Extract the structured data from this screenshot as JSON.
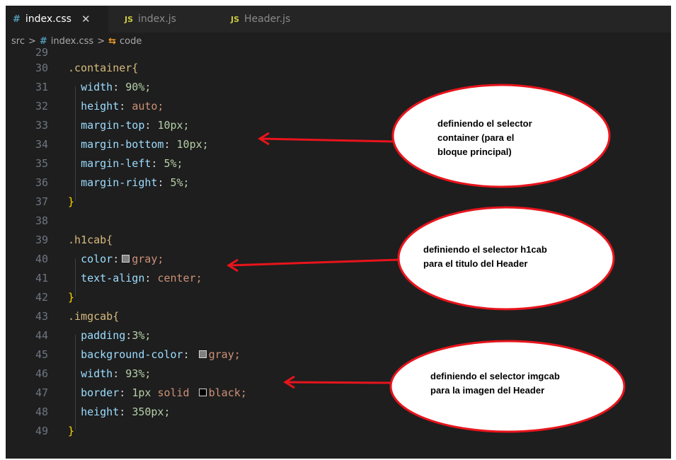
{
  "tabs": [
    {
      "label": "index.css",
      "icon": "#",
      "close": "✕",
      "active": true
    },
    {
      "label": "index.js",
      "icon": "JS",
      "active": false
    },
    {
      "label": "Header.js",
      "icon": "JS",
      "active": false
    }
  ],
  "breadcrumb": {
    "folder": "src",
    "sep": ">",
    "file": "index.css",
    "symbol": "code"
  },
  "code": {
    "partial_line": "29",
    "lines": [
      {
        "n": "30",
        "text": ".container{"
      },
      {
        "n": "31",
        "prop": "width",
        "value": "90%;"
      },
      {
        "n": "32",
        "prop": "height",
        "value": "auto;"
      },
      {
        "n": "33",
        "prop": "margin-top",
        "value": "10px;"
      },
      {
        "n": "34",
        "prop": "margin-bottom",
        "value": "10px;"
      },
      {
        "n": "35",
        "prop": "margin-left",
        "value": "5%;"
      },
      {
        "n": "36",
        "prop": "margin-right",
        "value": "5%;"
      },
      {
        "n": "37",
        "text": "}"
      },
      {
        "n": "38",
        "text": ""
      },
      {
        "n": "39",
        "text": ".h1cab{"
      },
      {
        "n": "40",
        "prop": "color",
        "value": "gray;"
      },
      {
        "n": "41",
        "prop": "text-align",
        "value": "center;"
      },
      {
        "n": "42",
        "text": "}"
      },
      {
        "n": "43",
        "text": ".imgcab{"
      },
      {
        "n": "44",
        "prop": "padding",
        "value": "3%;"
      },
      {
        "n": "45",
        "prop": "background-color",
        "value": "gray;"
      },
      {
        "n": "46",
        "prop": "width",
        "value": "93%;"
      },
      {
        "n": "47",
        "prop": "border",
        "value_num": "1px",
        "value_kw": "solid",
        "value_color": "black;"
      },
      {
        "n": "48",
        "prop": "height",
        "value": "350px;"
      },
      {
        "n": "49",
        "text": "}"
      }
    ]
  },
  "annotations": [
    {
      "line1": "definiendo el selector",
      "line2": "container (para el",
      "line3": "bloque principal)"
    },
    {
      "line1": "definiendo el selector h1cab",
      "line2": "para el titulo del Header"
    },
    {
      "line1": "definiendo el selector imgcab",
      "line2": "para la imagen del Header"
    }
  ],
  "colors": {
    "editor_bg": "#1e1e1e",
    "annotation_red": "#e8141c",
    "swatch_gray": "#808080",
    "swatch_black": "#000000"
  }
}
